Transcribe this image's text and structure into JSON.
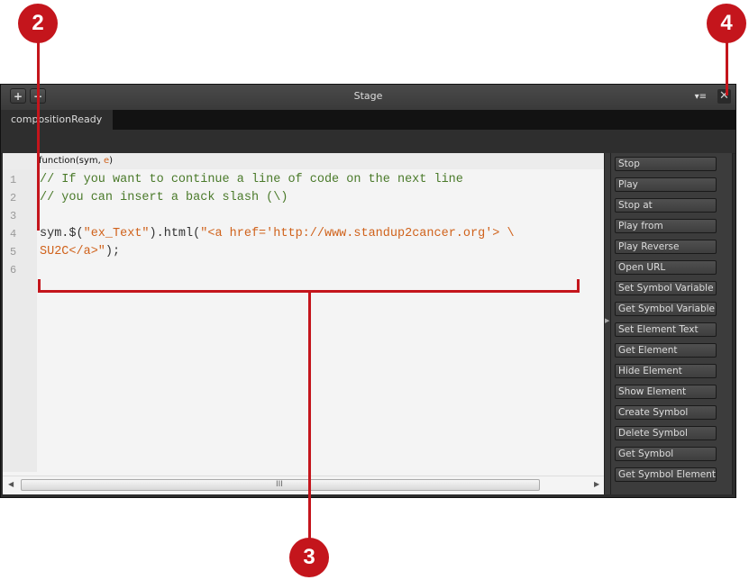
{
  "panel": {
    "title": "Stage",
    "add_button": "+",
    "remove_button": "−",
    "menu_icon": "▾≡",
    "close_icon": "✕"
  },
  "tabs": [
    {
      "label": "compositionReady"
    }
  ],
  "editor": {
    "function_header": "function(sym, ",
    "function_param": "e",
    "function_close": ")",
    "lines": [
      {
        "num": "1",
        "parts": [
          {
            "type": "comment",
            "text": "// If you want to continue a line of code on the next line"
          }
        ]
      },
      {
        "num": "2",
        "parts": [
          {
            "type": "comment",
            "text": "// you can insert a back slash (\\)"
          }
        ]
      },
      {
        "num": "3",
        "parts": []
      },
      {
        "num": "4",
        "parts": [
          {
            "type": "plain",
            "text": "sym.$("
          },
          {
            "type": "string",
            "text": "\"ex_Text\""
          },
          {
            "type": "plain",
            "text": ").html("
          },
          {
            "type": "string",
            "text": "\"<a href='http://www.standup2cancer.org'> \\"
          }
        ]
      },
      {
        "num": "5",
        "parts": [
          {
            "type": "string",
            "text": "SU2C</a>\""
          },
          {
            "type": "plain",
            "text": ");"
          }
        ]
      },
      {
        "num": "6",
        "parts": []
      }
    ],
    "scroll_grip": "III"
  },
  "actions": [
    "Stop",
    "Play",
    "Stop at",
    "Play from",
    "Play Reverse",
    "Open URL",
    "Set Symbol Variable",
    "Get Symbol Variable",
    "Set Element Text",
    "Get Element",
    "Hide Element",
    "Show Element",
    "Create Symbol",
    "Delete Symbol",
    "Get Symbol",
    "Get Symbol Element"
  ],
  "callouts": {
    "c2": "2",
    "c3": "3",
    "c4": "4"
  },
  "colors": {
    "callout": "#c4151c",
    "comment": "#4a7a2a",
    "string": "#d0621b"
  }
}
